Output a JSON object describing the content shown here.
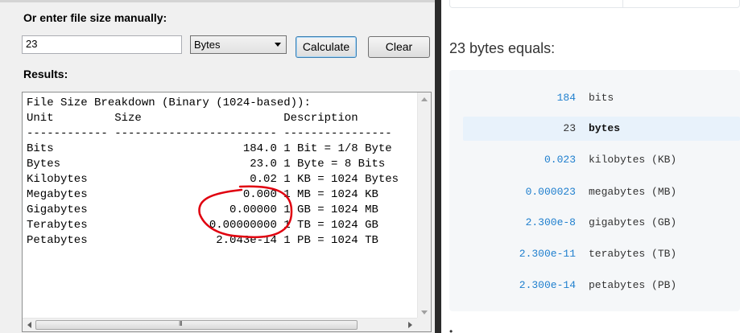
{
  "app": {
    "manual_label": "Or enter file size manually:",
    "size_input_value": "23",
    "unit_selected": "Bytes",
    "calculate_label": "Calculate",
    "clear_label": "Clear",
    "results_label": "Results:",
    "results_lines": [
      "File Size Breakdown (Binary (1024-based)):",
      "Unit         Size                     Description",
      "------------ ------------------------ ----------------",
      "Bits                            184.0 1 Bit = 1/8 Byte",
      "Bytes                            23.0 1 Byte = 8 Bits",
      "Kilobytes                        0.02 1 KB = 1024 Bytes",
      "Megabytes                       0.000 1 MB = 1024 KB",
      "Gigabytes                     0.00000 1 GB = 1024 MB",
      "Terabytes                  0.00000000 1 TB = 1024 GB",
      "Petabytes                   2.043e-14 1 PB = 1024 TB"
    ],
    "scroll_grip": "III",
    "annotation_color": "#e0000f"
  },
  "web": {
    "heading": "23 bytes equals:",
    "conversions": [
      {
        "value": "184",
        "unit": "bits",
        "highlighted": false
      },
      {
        "value": "23",
        "unit": "bytes",
        "highlighted": true
      },
      {
        "value": "0.023",
        "unit": "kilobytes (KB)",
        "highlighted": false
      },
      {
        "value": "0.000023",
        "unit": "megabytes (MB)",
        "highlighted": false
      },
      {
        "value": "2.300e-8",
        "unit": "gigabytes (GB)",
        "highlighted": false
      },
      {
        "value": "2.300e-11",
        "unit": "terabytes (TB)",
        "highlighted": false
      },
      {
        "value": "2.300e-14",
        "unit": "petabytes (PB)",
        "highlighted": false
      }
    ],
    "footer_glyph": "•",
    "accent_color": "#1f7fce"
  }
}
